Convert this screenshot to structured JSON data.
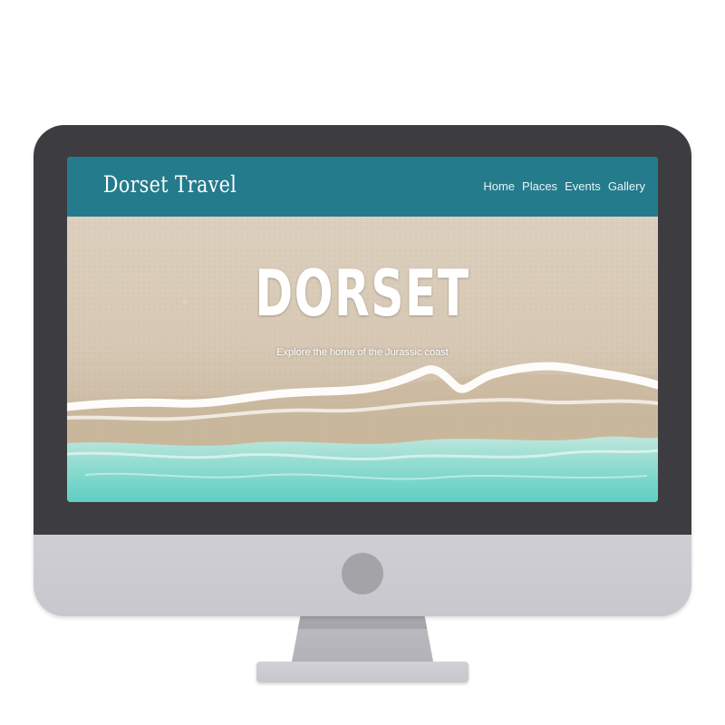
{
  "site": {
    "brand": "Dorset Travel",
    "nav": [
      {
        "label": "Home"
      },
      {
        "label": "Places"
      },
      {
        "label": "Events"
      },
      {
        "label": "Gallery"
      }
    ]
  },
  "hero": {
    "title": "DORSET",
    "subtitle": "Explore the home of the Jurassic coast"
  },
  "colors": {
    "header": "#247b8c",
    "bezel": "#3d3c40",
    "chin": "#cfced4",
    "sand": "#d6c8b4",
    "sea": "#6fd3c8"
  }
}
